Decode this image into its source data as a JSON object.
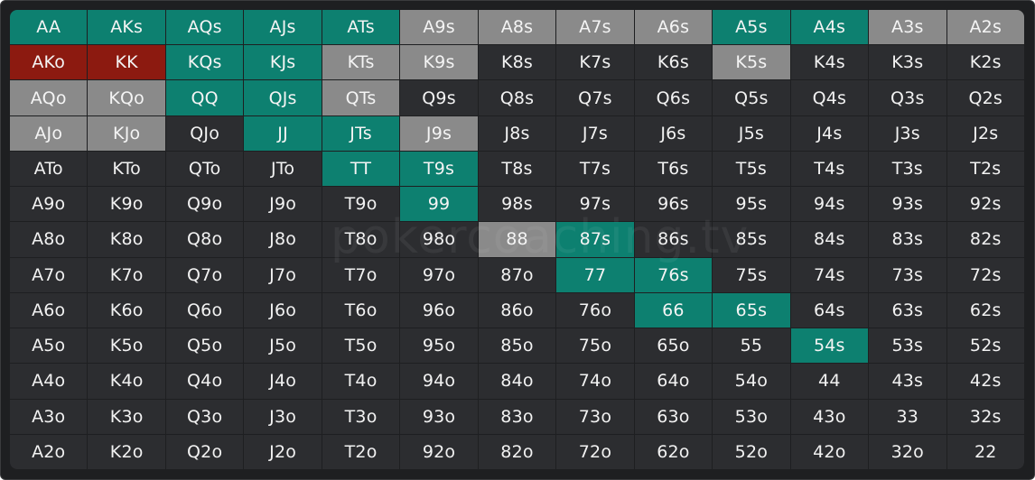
{
  "range_grid": {
    "ranks": [
      "A",
      "K",
      "Q",
      "J",
      "T",
      "9",
      "8",
      "7",
      "6",
      "5",
      "4",
      "3",
      "2"
    ],
    "colors": {
      "neutral": "#2c2d30",
      "raise": "#0d8070",
      "call": "#8a8a8a",
      "allin": "#8c1a10",
      "panel": "#1e1f21"
    },
    "highlights": {
      "raise": [
        "AA",
        "AKs",
        "AQs",
        "AJs",
        "ATs",
        "A5s",
        "A4s",
        "KQs",
        "KJs",
        "QQ",
        "QJs",
        "JJ",
        "JTs",
        "TT",
        "T9s",
        "99",
        "87s",
        "77",
        "76s",
        "66",
        "65s",
        "54s"
      ],
      "call": [
        "A9s",
        "A8s",
        "A7s",
        "A6s",
        "A3s",
        "A2s",
        "KTs",
        "K9s",
        "K5s",
        "AQo",
        "KQo",
        "QTs",
        "AJo",
        "KJo",
        "J9s",
        "88"
      ],
      "allin": [
        "AKo",
        "KK"
      ]
    }
  },
  "watermark": "pokercoaching.tv"
}
